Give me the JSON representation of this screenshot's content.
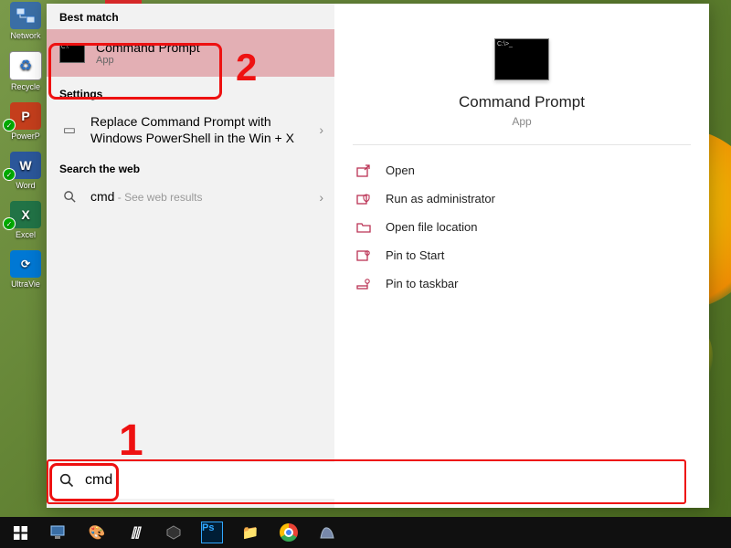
{
  "desktop_icons": [
    {
      "label": "Network",
      "type": "network"
    },
    {
      "label": "Recycle",
      "type": "recycle"
    },
    {
      "label": "PowerP",
      "type": "pp",
      "letter": "P",
      "badge": true
    },
    {
      "label": "Word",
      "type": "word",
      "letter": "W",
      "badge": true
    },
    {
      "label": "Excel",
      "type": "excel",
      "letter": "X",
      "badge": true
    },
    {
      "label": "UltraVie",
      "type": "uv",
      "letter": "⟳"
    }
  ],
  "startmenu": {
    "sections": {
      "best_match_hdr": "Best match",
      "settings_hdr": "Settings",
      "web_hdr": "Search the web"
    },
    "best_match": {
      "title": "Command Prompt",
      "subtitle": "App"
    },
    "settings_item": {
      "label": "Replace Command Prompt with Windows PowerShell in the Win + X"
    },
    "web_item": {
      "query": "cmd",
      "suffix": " - See web results"
    },
    "preview": {
      "title": "Command Prompt",
      "subtitle": "App"
    },
    "actions": [
      {
        "icon": "open",
        "label": "Open"
      },
      {
        "icon": "admin",
        "label": "Run as administrator"
      },
      {
        "icon": "folder",
        "label": "Open file location"
      },
      {
        "icon": "pin-start",
        "label": "Pin to Start"
      },
      {
        "icon": "pin-taskbar",
        "label": "Pin to taskbar"
      }
    ]
  },
  "search": {
    "value": "cmd"
  },
  "annotations": {
    "num1": "1",
    "num2": "2"
  }
}
